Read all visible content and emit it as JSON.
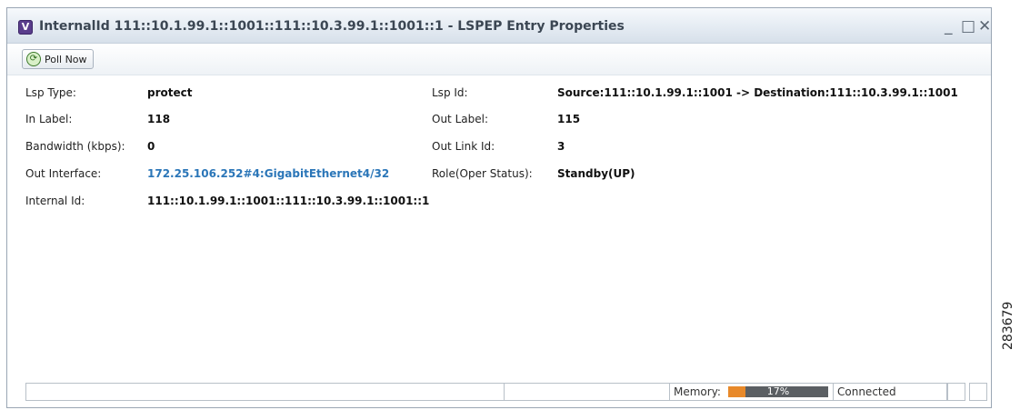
{
  "window": {
    "title": "InternalId 111::10.1.99.1::1001::111::10.3.99.1::1001::1 - LSPEP Entry Properties",
    "app_icon_letter": "V",
    "controls": {
      "minimize": "_",
      "maximize": "□",
      "close": "✕"
    }
  },
  "toolbar": {
    "poll_now_label": "Poll Now"
  },
  "properties": {
    "lsp_type": {
      "label": "Lsp Type:",
      "value": "protect"
    },
    "in_label": {
      "label": "In Label:",
      "value": "118"
    },
    "bandwidth": {
      "label": "Bandwidth (kbps):",
      "value": "0"
    },
    "out_interface": {
      "label": "Out Interface:",
      "value": "172.25.106.252#4:GigabitEthernet4/32"
    },
    "internal_id": {
      "label": "Internal Id:",
      "value": "111::10.1.99.1::1001::111::10.3.99.1::1001::1"
    },
    "lsp_id": {
      "label": "Lsp Id:",
      "value": "Source:111::10.1.99.1::1001 -> Destination:111::10.3.99.1::1001"
    },
    "out_label": {
      "label": "Out Label:",
      "value": "115"
    },
    "out_link_id": {
      "label": "Out Link Id:",
      "value": "3"
    },
    "role": {
      "label": "Role(Oper Status):",
      "value": "Standby(UP)"
    }
  },
  "statusbar": {
    "memory_label": "Memory:",
    "memory_percent_text": "17%",
    "memory_fraction": 0.17,
    "connection_status": "Connected"
  },
  "side_label": "283679"
}
